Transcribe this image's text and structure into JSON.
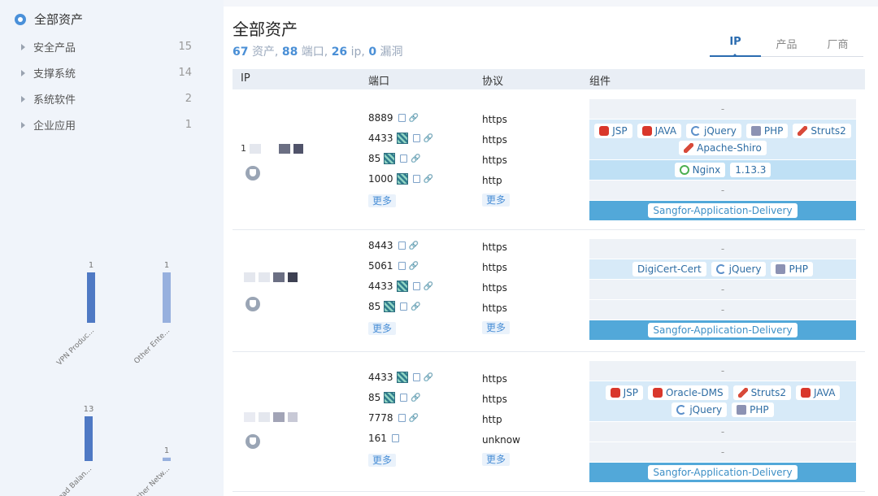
{
  "sidebar": {
    "root_label": "全部资产",
    "items": [
      {
        "label": "安全产品",
        "count": "15"
      },
      {
        "label": "支撑系统",
        "count": "14"
      },
      {
        "label": "系统软件",
        "count": "2"
      },
      {
        "label": "企业应用",
        "count": "1"
      }
    ]
  },
  "chart_data": [
    {
      "type": "bar",
      "categories": [
        "VPN Produc...",
        "Other Ente..."
      ],
      "values": [
        1,
        1
      ],
      "colors": [
        "#4f79c4",
        "#97b0de"
      ]
    },
    {
      "type": "bar",
      "categories": [
        "Load Balan...",
        "Other Netw..."
      ],
      "values": [
        13,
        1
      ],
      "colors": [
        "#4f79c4",
        "#97b0de"
      ]
    }
  ],
  "header": {
    "title": "全部资产",
    "summary": {
      "assets_num": "67",
      "assets_label": "资产,",
      "ports_num": "88",
      "ports_label": "端口,",
      "ips_num": "26",
      "ips_label": "ip,",
      "vulns_num": "0",
      "vulns_label": "漏洞"
    },
    "tabs": [
      "IP",
      "产品",
      "厂商"
    ],
    "active_tab": "IP"
  },
  "table": {
    "columns": [
      "IP",
      "端口",
      "协议",
      "组件"
    ],
    "more_label": "更多",
    "rows": [
      {
        "ip_prefix": "1",
        "ports": [
          {
            "port": "8889",
            "icon": false
          },
          {
            "port": "4433",
            "icon": true
          },
          {
            "port": "85",
            "icon": true
          },
          {
            "port": "1000",
            "icon": true
          }
        ],
        "protocols": [
          "https",
          "https",
          "https",
          "http"
        ],
        "components": [
          {
            "style": "empty",
            "text": "-"
          },
          {
            "style": "light",
            "chips": [
              {
                "icon": "oracle",
                "label": "JSP"
              },
              {
                "icon": "oracle",
                "label": "JAVA"
              },
              {
                "icon": "jquery",
                "label": "jQuery"
              },
              {
                "icon": "php",
                "label": "PHP"
              },
              {
                "icon": "struts",
                "label": "Struts2"
              },
              {
                "icon": "struts",
                "label": "Apache-Shiro"
              }
            ]
          },
          {
            "style": "mid",
            "chips": [
              {
                "icon": "g",
                "label": "Nginx"
              },
              {
                "icon": "none",
                "label": "1.13.3"
              }
            ]
          },
          {
            "style": "empty",
            "text": "-"
          },
          {
            "style": "dark",
            "chips": [
              {
                "icon": "none",
                "label": "Sangfor-Application-Delivery"
              }
            ]
          }
        ]
      },
      {
        "ip_prefix": "",
        "ports": [
          {
            "port": "8443",
            "icon": false
          },
          {
            "port": "5061",
            "icon": false
          },
          {
            "port": "4433",
            "icon": true
          },
          {
            "port": "85",
            "icon": true
          }
        ],
        "protocols": [
          "https",
          "https",
          "https",
          "https"
        ],
        "components": [
          {
            "style": "empty",
            "text": "-"
          },
          {
            "style": "light",
            "chips": [
              {
                "icon": "none",
                "label": "DigiCert-Cert"
              },
              {
                "icon": "jquery",
                "label": "jQuery"
              },
              {
                "icon": "php",
                "label": "PHP"
              }
            ]
          },
          {
            "style": "empty",
            "text": "-"
          },
          {
            "style": "empty",
            "text": "-"
          },
          {
            "style": "dark",
            "chips": [
              {
                "icon": "none",
                "label": "Sangfor-Application-Delivery"
              }
            ]
          }
        ]
      },
      {
        "ip_prefix": "",
        "ports": [
          {
            "port": "4433",
            "icon": true
          },
          {
            "port": "85",
            "icon": true
          },
          {
            "port": "7778",
            "icon": false
          },
          {
            "port": "161",
            "icon": false
          }
        ],
        "protocols": [
          "https",
          "https",
          "http",
          "unknow"
        ],
        "components": [
          {
            "style": "empty",
            "text": "-"
          },
          {
            "style": "light",
            "chips": [
              {
                "icon": "oracle",
                "label": "JSP"
              },
              {
                "icon": "oracle",
                "label": "Oracle-DMS"
              },
              {
                "icon": "struts",
                "label": "Struts2"
              },
              {
                "icon": "oracle",
                "label": "JAVA"
              },
              {
                "icon": "jquery",
                "label": "jQuery"
              },
              {
                "icon": "php",
                "label": "PHP"
              }
            ]
          },
          {
            "style": "empty",
            "text": "-"
          },
          {
            "style": "empty",
            "text": "-"
          },
          {
            "style": "dark",
            "chips": [
              {
                "icon": "none",
                "label": "Sangfor-Application-Delivery"
              }
            ]
          }
        ]
      }
    ]
  }
}
